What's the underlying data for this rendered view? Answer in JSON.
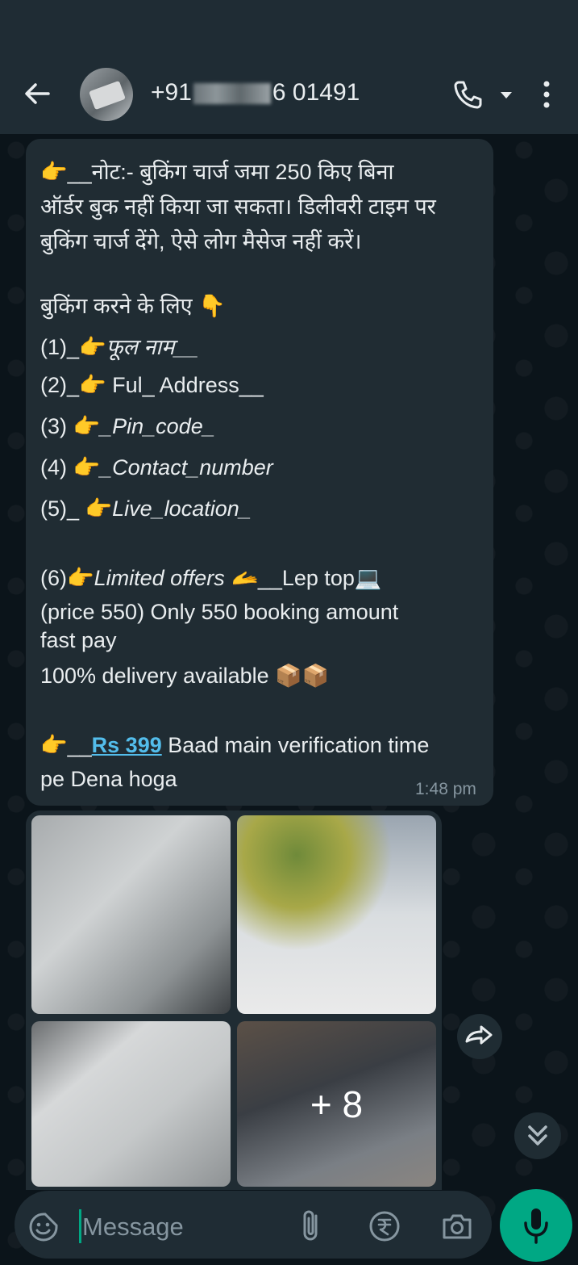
{
  "header": {
    "contact_prefix": "+91",
    "contact_suffix": "6 01491",
    "back_icon": "arrow-left-icon",
    "call_icon": "phone-icon",
    "menu_icon": "more-vertical-icon"
  },
  "message": {
    "lines": [
      "👉__नोट:- बुकिंग चार्ज जमा 250 किए बिना",
      "ऑर्डर बुक नहीं किया जा सकता।  डिलीवरी टाइम पर",
      "बुकिंग चार्ज देंगे, ऐसे लोग मैसेज नहीं करें।",
      "बुकिंग करने के लिए  👇",
      "(1)_👉",
      "फूल  नाम__",
      "(2)_👉 Ful_ Address__",
      "(3) 👉",
      "_Pin_code_",
      "(4) 👉",
      "_Contact_number",
      "(5)_ 👉",
      "Live_location_",
      "(6)👉",
      "Limited offers 🫴",
      "__Lep top💻",
      "(price 550) Only 550 booking amount",
      "fast pay",
      "100% delivery available 📦📦",
      "👉__",
      "Rs 399",
      " Baad main verification time",
      "pe Dena hoga"
    ],
    "time": "1:48 pm"
  },
  "media": {
    "more_count": "+ 8"
  },
  "composer": {
    "placeholder": "Message"
  },
  "colors": {
    "accent": "#00a884",
    "bubble": "#202c33",
    "header": "#1f2c34",
    "background": "#0b141a",
    "link": "#53bdeb"
  }
}
